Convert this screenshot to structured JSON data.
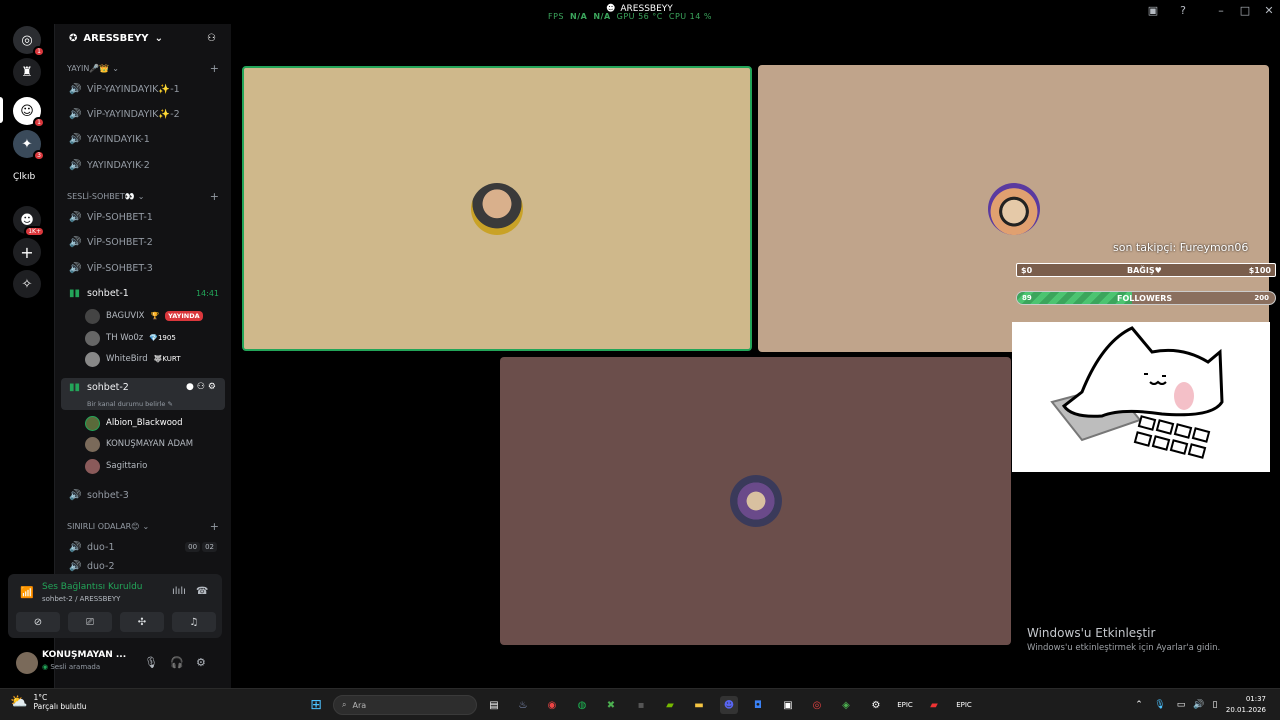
{
  "hud": {
    "fps_label": "FPS",
    "fps_val": "N/A",
    "fps_val2": "N/A",
    "gpu": "GPU 56 °C",
    "cpu": "CPU 14 %"
  },
  "window": {
    "title": "ARESSBEYY"
  },
  "rail": {
    "label_cikub": "Çlkıb",
    "badge1": "1",
    "badge2": "1",
    "badge3": "3",
    "badge4": "1K+"
  },
  "guild": {
    "name": "ARESSBEYY"
  },
  "categories": {
    "yayin": "YAYIN🎤👑",
    "sesli": "SESLİ-SOHBET👀",
    "sinirli": "SINIRLI ODALAR😊"
  },
  "channels": {
    "vip_y1": "VİP-YAYINDAYIK✨-1",
    "vip_y2": "VİP-YAYINDAYIK✨-2",
    "y1": "YAYINDAYIK-1",
    "y2": "YAYINDAYIK-2",
    "vip_s1": "VİP-SOHBET-1",
    "vip_s2": "VİP-SOHBET-2",
    "vip_s3": "VİP-SOHBET-3",
    "sohbet1": "sohbet-1",
    "sohbet1_time": "14:41",
    "sohbet2": "sohbet-2",
    "sohbet2_status": "Bir kanal durumu belirle",
    "sohbet3": "sohbet-3",
    "duo1": "duo-1",
    "duo1_a": "00",
    "duo1_b": "02",
    "duo2": "duo-2"
  },
  "members1": [
    {
      "name": "BAGUVIX",
      "tag": "",
      "live": "YAYINDA"
    },
    {
      "name": "TH Wo0z",
      "tag": "💎1905"
    },
    {
      "name": "WhiteBird",
      "tag": "🐺KURT"
    }
  ],
  "members2": [
    {
      "name": "Albion_Blackwood"
    },
    {
      "name": "KONUŞMAYAN ADAM"
    },
    {
      "name": "Sagittario"
    }
  ],
  "voice": {
    "status": "Ses Bağlantısı Kuruldu",
    "sub": "sohbet-2 / ARESSBEYY"
  },
  "user": {
    "name": "KONUŞMAYAN ...",
    "status": "Sesli aramada"
  },
  "overlay": {
    "follower": "son takipçi: Fureymon06",
    "don_min": "$0",
    "don_label": "BAĞIŞ♥",
    "don_max": "$100",
    "fol_min": "89",
    "fol_label": "FOLLOWERS",
    "fol_max": "200",
    "fol_progress": 0.445
  },
  "watermark": {
    "line1": "Windows'u Etkinleştir",
    "line2": "Windows'u etkinleştirmek için Ayarlar'a gidin."
  },
  "taskbar": {
    "temp": "1°C",
    "weather": "Parçalı bulutlu",
    "search_placeholder": "Ara",
    "time": "01:37",
    "date": "20.01.2026"
  },
  "colors": {
    "tile1": "#cfb88b",
    "tile2": "#c0a48b",
    "tile3": "#6b4e4b",
    "speaking": "#23a559"
  }
}
